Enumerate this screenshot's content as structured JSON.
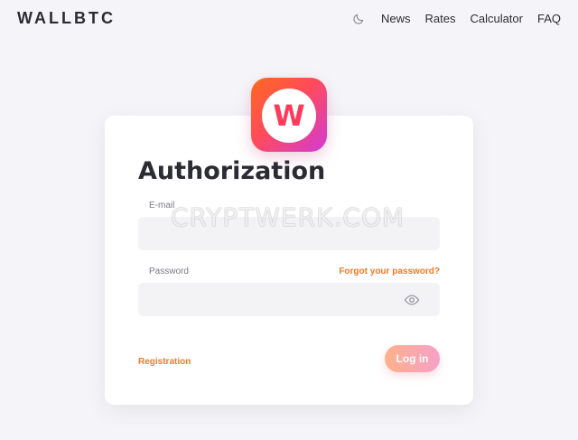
{
  "header": {
    "logo": "WALLBTC",
    "theme_icon": "moon-icon",
    "nav": [
      {
        "label": "News"
      },
      {
        "label": "Rates"
      },
      {
        "label": "Calculator"
      },
      {
        "label": "FAQ"
      }
    ]
  },
  "app_icon": {
    "letter": "W",
    "colors": {
      "start": "#ff6a1f",
      "end": "#d13bd6",
      "letter": "#ff3a5c"
    }
  },
  "form": {
    "title": "Authorization",
    "email_label": "E-mail",
    "email_value": "",
    "password_label": "Password",
    "password_value": "",
    "forgot_link": "Forgot your password?",
    "register_link": "Registration",
    "login_button": "Log in",
    "eye_icon": "eye-icon"
  },
  "watermark": "CRYPTWERK.COM",
  "colors": {
    "accent": "#f07a2a",
    "text": "#2b2b33",
    "background": "#f5f5f9"
  }
}
